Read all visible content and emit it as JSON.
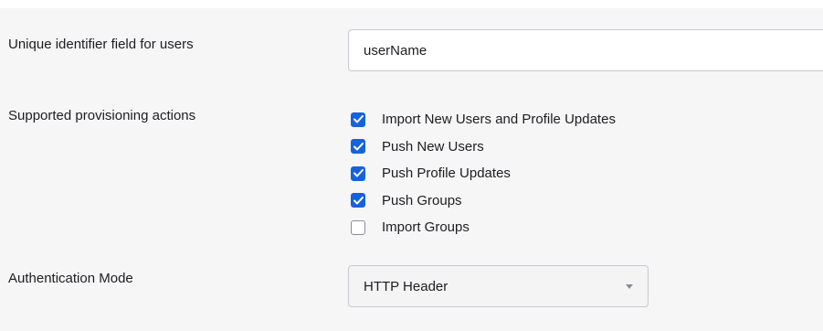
{
  "unique_identifier": {
    "label": "Unique identifier field for users",
    "value": "userName"
  },
  "provisioning": {
    "label": "Supported provisioning actions",
    "actions": [
      {
        "label": "Import New Users and Profile Updates",
        "checked": true
      },
      {
        "label": "Push New Users",
        "checked": true
      },
      {
        "label": "Push Profile Updates",
        "checked": true
      },
      {
        "label": "Push Groups",
        "checked": true
      },
      {
        "label": "Import Groups",
        "checked": false
      }
    ]
  },
  "auth_mode": {
    "label": "Authentication Mode",
    "selected": "HTTP Header",
    "arrow_icon": "caret-down-icon"
  },
  "colors": {
    "accent": "#1662dd",
    "panel_background": "#f6f6f7",
    "border": "#c9c9d0"
  }
}
